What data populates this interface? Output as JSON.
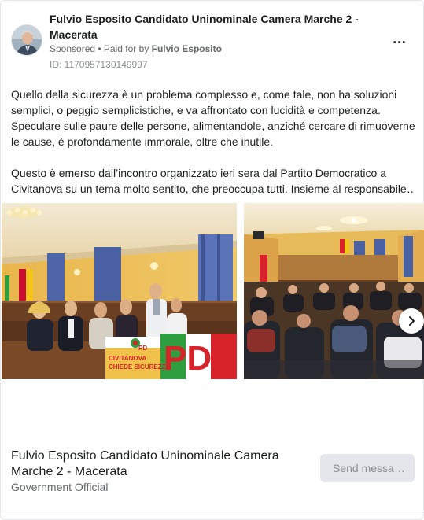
{
  "header": {
    "page_name": "Fulvio Esposito Candidato Uninominale Camera Marche 2 - Macerata",
    "sponsored": "Sponsored",
    "separator": " • ",
    "paid_for_prefix": "Paid for by ",
    "payer": "Fulvio Esposito",
    "ad_id": "ID: 1170957130149997",
    "more_icon": "…"
  },
  "post": {
    "paragraph1": "Quello della sicurezza è un problema complesso e, come tale, non ha soluzioni semplici, o peggio semplicistiche, e va affrontato con lucidità e competenza. Speculare sulle paure delle persone, alimentandole, anziché cercare di rimuoverne le cause, è profondamente immorale, oltre che inutile.",
    "paragraph2_line1": "Questo è emerso dall’incontro organizzato ieri sera dal Partito Democratico a",
    "paragraph2_line2": "Civitanova su un tema molto sentito, che preoccupa tutti. Insieme al responsabile…"
  },
  "media": {
    "photo1_banner_top": "CIVITANOVA",
    "photo1_banner_bottom": "CHIEDE SICUREZZ",
    "photo1_party_letters": "PD",
    "photo1_logo_letters": "PD",
    "next_icon": "chevron-right-icon"
  },
  "footer": {
    "name": "Fulvio Esposito Candidato Uninominale Camera Marche 2 - Macerata",
    "category": "Government Official",
    "send_button": "Send messa…"
  },
  "colors": {
    "text_primary": "#1c1e21",
    "text_secondary": "#65676b",
    "button_bg": "#e4e6eb",
    "party_red": "#d8232a",
    "party_green": "#2e9e3f"
  }
}
